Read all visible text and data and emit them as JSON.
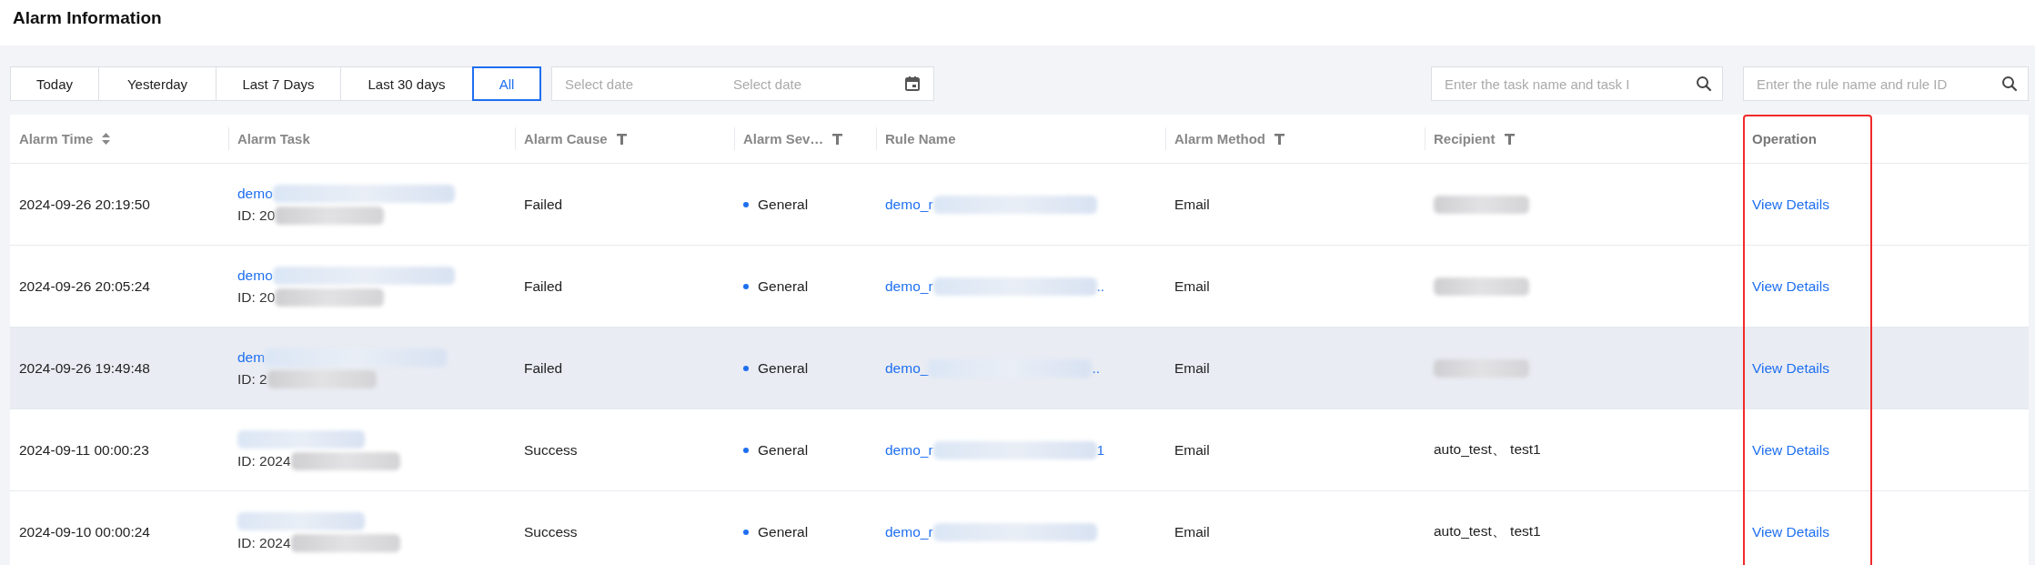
{
  "page_title": "Alarm Information",
  "quick_ranges": [
    {
      "label": "Today",
      "selected": false
    },
    {
      "label": "Yesterday",
      "selected": false
    },
    {
      "label": "Last 7 Days",
      "selected": false
    },
    {
      "label": "Last 30 days",
      "selected": false
    },
    {
      "label": "All",
      "selected": true
    }
  ],
  "date_range": {
    "start_placeholder": "Select date",
    "end_placeholder": "Select date"
  },
  "task_search": {
    "placeholder": "Enter the task name and task I"
  },
  "rule_search": {
    "placeholder": "Enter the rule name and rule ID"
  },
  "table": {
    "columns": [
      {
        "label": "Alarm Time",
        "kind": "sortable",
        "highlighted": false
      },
      {
        "label": "Alarm Task",
        "kind": "plain",
        "highlighted": false
      },
      {
        "label": "Alarm Cause",
        "kind": "filterable",
        "highlighted": false
      },
      {
        "label": "Alarm Sev…",
        "kind": "filterable",
        "highlighted": false
      },
      {
        "label": "Rule Name",
        "kind": "plain",
        "highlighted": false
      },
      {
        "label": "Alarm Method",
        "kind": "filterable",
        "highlighted": false
      },
      {
        "label": "Recipient",
        "kind": "filterable",
        "highlighted": false
      },
      {
        "label": "Operation",
        "kind": "plain",
        "highlighted": true
      }
    ],
    "rows": [
      {
        "time": "2024-09-26 20:19:50",
        "task_name": "demo",
        "task_id": "ID: 20",
        "cause": "Failed",
        "severity": "General",
        "color": "#1e6ff0",
        "rule": "demo_r",
        "method": "Email",
        "action": "View Details",
        "hovered": false
      },
      {
        "time": "2024-09-26 20:05:24",
        "task_name": "demo",
        "task_id": "ID: 20",
        "cause": "Failed",
        "severity": "General",
        "color": "#1e6ff0",
        "rule": "demo_r",
        "rule_suffix": "..",
        "method": "Email",
        "action": "View Details",
        "hovered": false
      },
      {
        "time": "2024-09-26 19:49:48",
        "task_name": "dem",
        "task_id": "ID: 2",
        "cause": "Failed",
        "severity": "General",
        "color": "#1e6ff0",
        "rule": "demo_",
        "rule_suffix": "..",
        "method": "Email",
        "action": "View Details",
        "hovered": true
      },
      {
        "time": "2024-09-11 00:00:23",
        "task_id": "ID: 2024",
        "cause": "Success",
        "severity": "General",
        "color": "#1e6ff0",
        "rule": "demo_r",
        "rule_suffix": "1",
        "method": "Email",
        "recipient": "auto_test、 test1",
        "action": "View Details",
        "hovered": false
      },
      {
        "time": "2024-09-10 00:00:24",
        "task_id": "ID: 2024",
        "cause": "Success",
        "severity": "General",
        "color": "#1e6ff0",
        "rule": "demo_r",
        "method": "Email",
        "recipient": "auto_test、 test1",
        "action": "View Details",
        "hovered": false
      }
    ]
  }
}
